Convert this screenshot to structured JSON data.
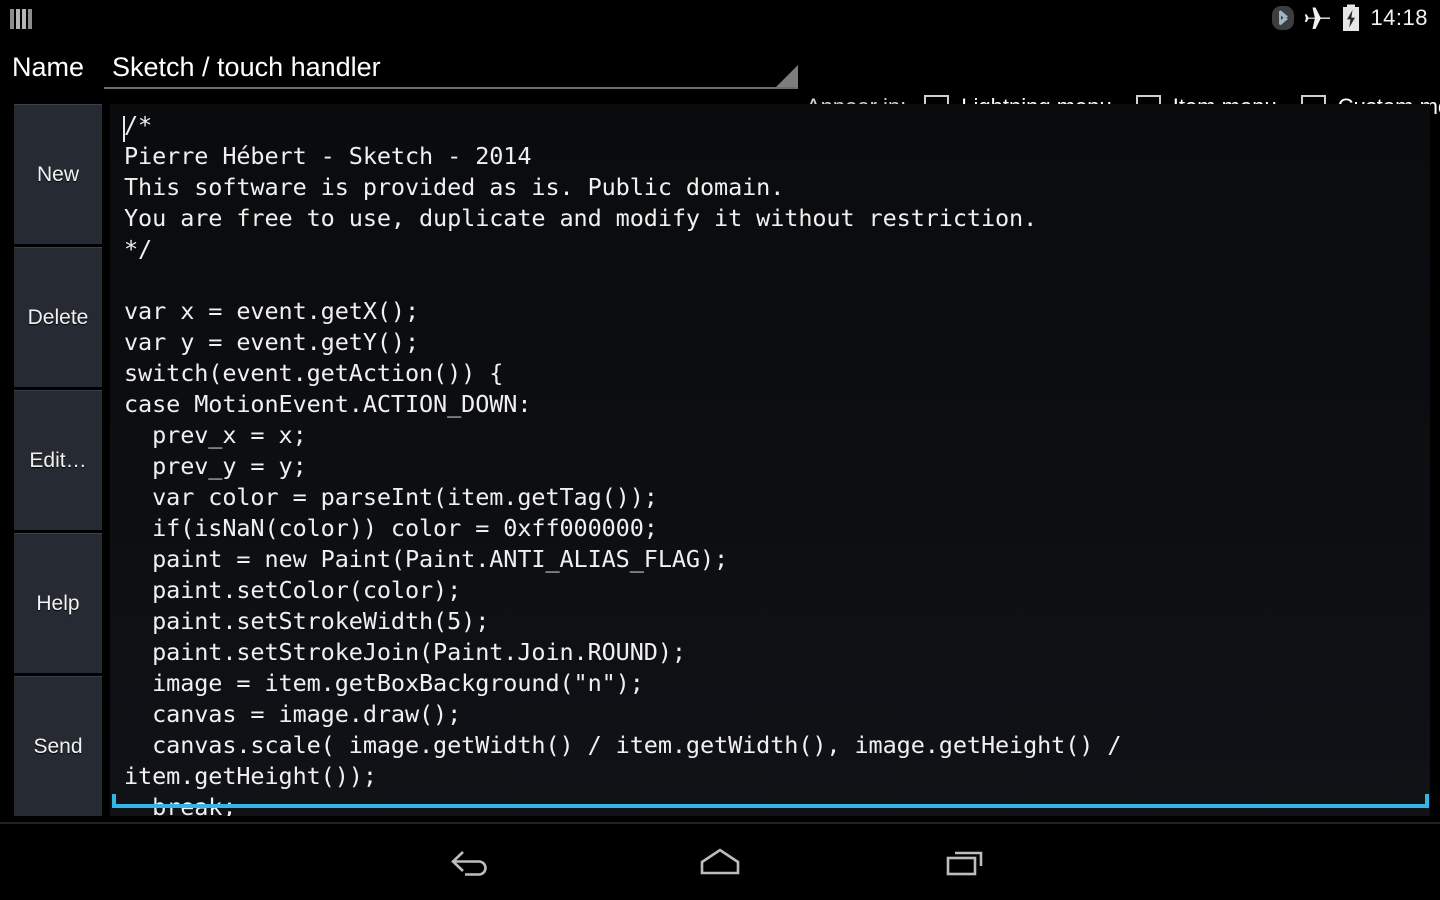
{
  "statusbar": {
    "notification_icon": "bars-icon",
    "icons": [
      "bluetooth-icon",
      "airplane-mode-icon",
      "battery-charging-icon"
    ],
    "time": "14:18"
  },
  "header": {
    "name_label": "Name",
    "name_value": "Sketch / touch handler",
    "name_placeholder": "Name",
    "resize_handle_icon": "resize-handle-icon",
    "appear_in_label": "Appear in:",
    "checkboxes": [
      {
        "label": "Lightning menu",
        "checked": false
      },
      {
        "label": "Item menu",
        "checked": false
      },
      {
        "label": "Custom menu",
        "checked": false
      }
    ]
  },
  "sidebar": {
    "items": [
      {
        "label": "New"
      },
      {
        "label": "Delete"
      },
      {
        "label": "Edit…"
      },
      {
        "label": "Help"
      },
      {
        "label": "Send"
      }
    ]
  },
  "editor": {
    "focus_color": "#33b5e5",
    "caret_visible": true,
    "code": "/*\nPierre Hébert - Sketch - 2014\nThis software is provided as is. Public domain.\nYou are free to use, duplicate and modify it without restriction.\n*/\n\nvar x = event.getX();\nvar y = event.getY();\nswitch(event.getAction()) {\ncase MotionEvent.ACTION_DOWN:\n  prev_x = x;\n  prev_y = y;\n  var color = parseInt(item.getTag());\n  if(isNaN(color)) color = 0xff000000;\n  paint = new Paint(Paint.ANTI_ALIAS_FLAG);\n  paint.setColor(color);\n  paint.setStrokeWidth(5);\n  paint.setStrokeJoin(Paint.Join.ROUND);\n  image = item.getBoxBackground(\"n\");\n  canvas = image.draw();\n  canvas.scale( image.getWidth() / item.getWidth(), image.getHeight() /\nitem.getHeight());\n  break;"
  },
  "navbar": {
    "buttons": [
      {
        "name": "back",
        "icon": "back-arrow-icon"
      },
      {
        "name": "home",
        "icon": "home-icon"
      },
      {
        "name": "recents",
        "icon": "recents-icon"
      }
    ]
  }
}
